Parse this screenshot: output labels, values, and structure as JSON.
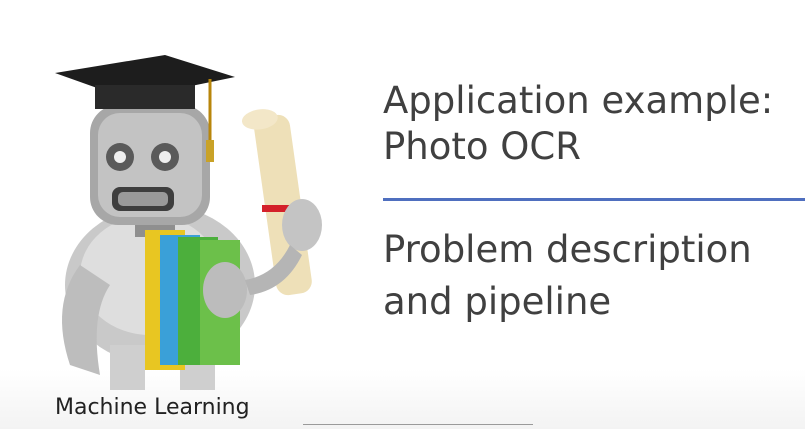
{
  "slide": {
    "title_line1": "Application example:",
    "title_line2": "Photo OCR",
    "subtitle_line1": "Problem description",
    "subtitle_line2": "and pipeline",
    "course_label": "Machine Learning"
  },
  "colors": {
    "divider": "#4f6fbf",
    "text": "#404040"
  },
  "icons": {
    "mascot": "graduate-robot-icon"
  }
}
